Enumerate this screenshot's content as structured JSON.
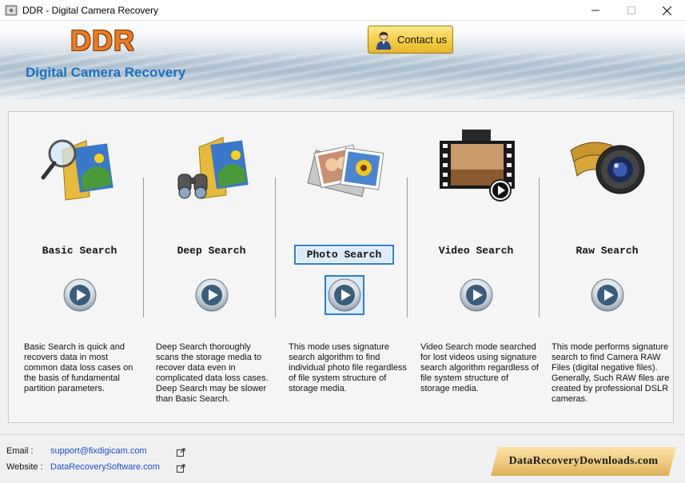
{
  "window": {
    "title": "DDR - Digital Camera Recovery"
  },
  "banner": {
    "logo_text": "DDR",
    "subtitle": "Digital Camera Recovery",
    "contact_label": "Contact us"
  },
  "modes": [
    {
      "title": "Basic Search",
      "description": "Basic Search is quick and recovers data in most common data loss cases on the basis of fundamental partition parameters.",
      "icon": "folder-magnifier-icon",
      "selected": false
    },
    {
      "title": "Deep Search",
      "description": "Deep Search thoroughly scans the storage media to recover data even in complicated data loss cases. Deep Search may be slower than Basic Search.",
      "icon": "folder-binoculars-icon",
      "selected": false
    },
    {
      "title": "Photo Search",
      "description": "This mode uses signature search algorithm to find individual photo file regardless of file system structure of storage media.",
      "icon": "photos-icon",
      "selected": true
    },
    {
      "title": "Video Search",
      "description": "Video Search mode searched for lost videos using signature search algorithm regardless of file system structure of storage media.",
      "icon": "film-video-icon",
      "selected": false
    },
    {
      "title": "Raw Search",
      "description": "This mode performs signature search to find Camera RAW Files (digital negative files). Generally, Such RAW files are created by professional DSLR cameras.",
      "icon": "camera-lens-film-icon",
      "selected": false
    }
  ],
  "footer": {
    "email_label": "Email :",
    "email_value": "support@fixdigicam.com",
    "website_label": "Website :",
    "website_value": "DataRecoverySoftware.com",
    "badge_text": "DataRecoveryDownloads.com"
  },
  "colors": {
    "accent": "#2c7fd0",
    "logo_orange": "#f07a20",
    "subtitle_blue": "#1a6fc0",
    "link_blue": "#1a4fd0"
  }
}
